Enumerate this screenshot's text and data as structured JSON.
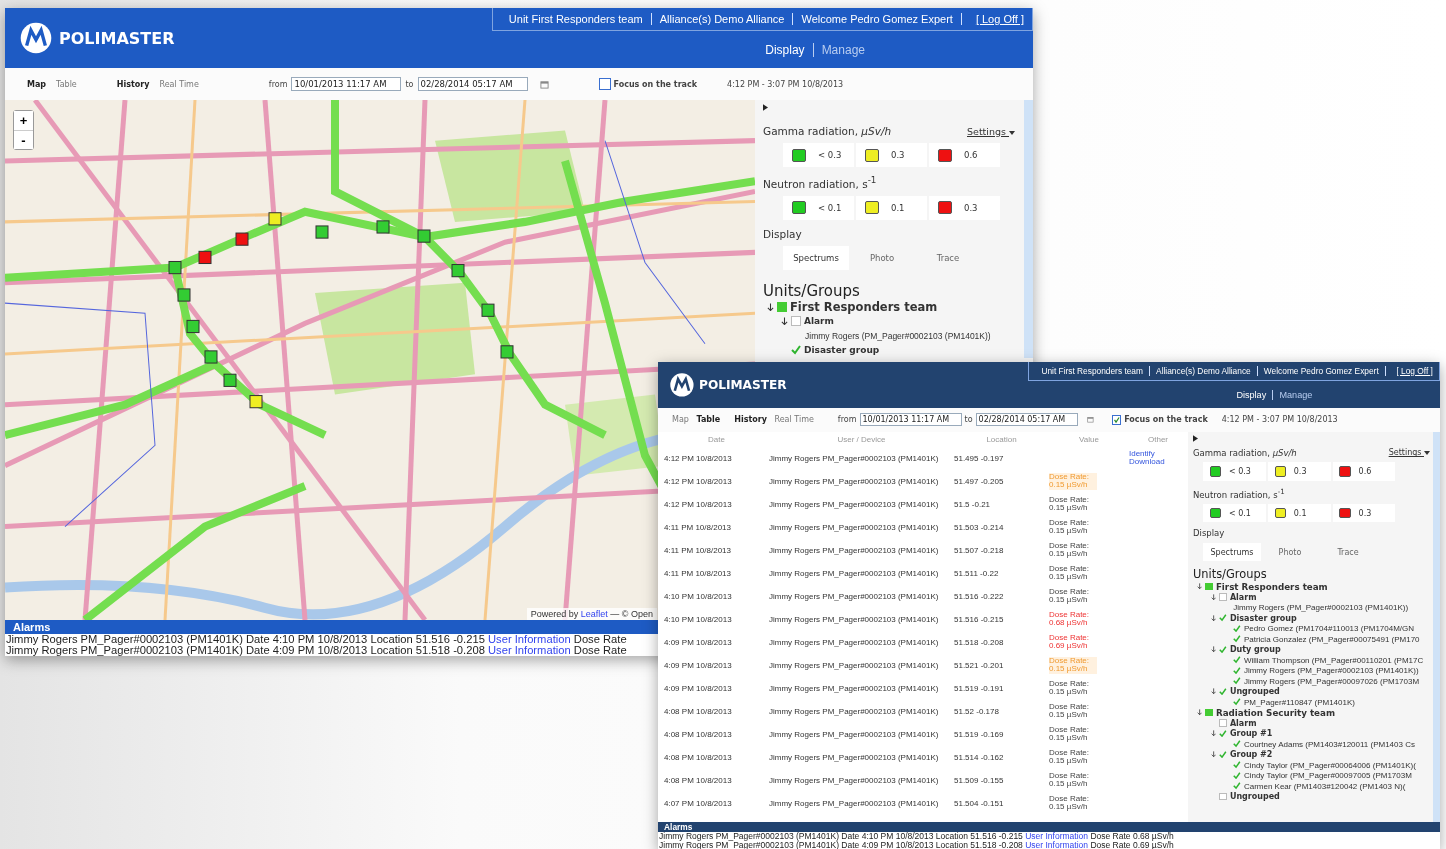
{
  "windows": [
    {
      "kind": "map",
      "brand": "POLIMASTER",
      "header_links": [
        "Unit First Responders team",
        "Alliance(s) Demo Alliance",
        "Welcome Pedro Gomez Expert"
      ],
      "logoff": "[ Log Off ]",
      "nav": [
        {
          "label": "Display",
          "selected": true
        },
        {
          "label": "Manage",
          "selected": false
        }
      ],
      "toolbar": {
        "views": [
          {
            "label": "Map",
            "selected": true
          },
          {
            "label": "Table",
            "selected": false
          }
        ],
        "modes": [
          {
            "label": "History",
            "selected": true
          },
          {
            "label": "Real Time",
            "selected": false
          }
        ],
        "from_label": "from",
        "from": "10/01/2013 11:17 AM",
        "to_label": "to",
        "to": "02/28/2014 05:17 AM",
        "focus": {
          "label": "Focus on the track",
          "checked": false
        },
        "range": "4:12 PM - 3:07 PM 10/8/2013"
      },
      "map": {
        "zoom_in": "+",
        "zoom_out": "-",
        "attribution_prefix": "Powered by",
        "attribution_link": "Leaflet",
        "attribution_suffix": "— © Open"
      },
      "panel": {
        "gamma_title": "Gamma radiation, *µSv/h*",
        "settings": "Settings",
        "gamma": [
          {
            "color": "#22cc22",
            "label": "< 0.3"
          },
          {
            "color": "#eeee22",
            "label": "0.3"
          },
          {
            "color": "#ee1111",
            "label": "0.6"
          }
        ],
        "neutron_title": "Neutron radiation, s$^{-1}$",
        "neutron": [
          {
            "color": "#22cc22",
            "label": "< 0.1"
          },
          {
            "color": "#eeee22",
            "label": "0.1"
          },
          {
            "color": "#ee1111",
            "label": "0.3"
          }
        ],
        "display_label": "Display",
        "display_tabs": [
          {
            "label": "Spectrums",
            "selected": true
          },
          {
            "label": "Photo",
            "selected": false
          },
          {
            "label": "Trace",
            "selected": false
          }
        ],
        "units_title": "Units/Groups",
        "tree": [
          {
            "kind": "team",
            "label": "First Responders team",
            "checked": true,
            "children": [
              {
                "kind": "group",
                "label": "Alarm",
                "checked": false,
                "children": [
                  {
                    "kind": "member",
                    "label": "Jimmy Rogers (PM_Pager#0002103 (PM1401K))"
                  }
                ]
              },
              {
                "kind": "group",
                "label": "Disaster group",
                "checked": true
              }
            ]
          }
        ]
      },
      "alarms": {
        "title": "Alarms",
        "rows": [
          {
            "text": "Jimmy Rogers PM_Pager#0002103 (PM1401K) Date 4:10 PM 10/8/2013 Location 51.516 -0.215",
            "link": "User Information",
            "tail": "Dose Rate"
          },
          {
            "text": "Jimmy Rogers PM_Pager#0002103 (PM1401K) Date 4:09 PM 10/8/2013 Location 51.518 -0.208",
            "link": "User Information",
            "tail": "Dose Rate"
          }
        ]
      }
    },
    {
      "kind": "table",
      "brand": "POLIMASTER",
      "header_links": [
        "Unit First Responders team",
        "Alliance(s) Demo Alliance",
        "Welcome Pedro Gomez Expert"
      ],
      "logoff": "[ Log Off ]",
      "nav": [
        {
          "label": "Display",
          "selected": true
        },
        {
          "label": "Manage",
          "selected": false
        }
      ],
      "toolbar": {
        "views": [
          {
            "label": "Map",
            "selected": false
          },
          {
            "label": "Table",
            "selected": true
          }
        ],
        "modes": [
          {
            "label": "History",
            "selected": true
          },
          {
            "label": "Real Time",
            "selected": false
          }
        ],
        "from_label": "from",
        "from": "10/01/2013 11:17 AM",
        "to_label": "to",
        "to": "02/28/2014 05:17 AM",
        "focus": {
          "label": "Focus on the track",
          "checked": true
        },
        "range": "4:12 PM - 3:07 PM 10/8/2013"
      },
      "table": {
        "columns": [
          "Date",
          "User / Device",
          "Location",
          "Value",
          "Other"
        ],
        "rows": [
          {
            "date": "4:12 PM 10/8/2013",
            "device": "Jimmy Rogers PM_Pager#0002103 (PM1401K)",
            "location": "51.495 -0.197",
            "kind": "none",
            "other": [
              "Identify",
              "Download"
            ]
          },
          {
            "date": "4:12 PM 10/8/2013",
            "device": "Jimmy Rogers PM_Pager#0002103 (PM1401K)",
            "location": "51.497 -0.205",
            "kind": "warning",
            "value": "Dose Rate: 0.15 µSv/h"
          },
          {
            "date": "4:12 PM 10/8/2013",
            "device": "Jimmy Rogers PM_Pager#0002103 (PM1401K)",
            "location": "51.5 -0.21",
            "kind": "normal",
            "value": "Dose Rate: 0.15 µSv/h"
          },
          {
            "date": "4:11 PM 10/8/2013",
            "device": "Jimmy Rogers PM_Pager#0002103 (PM1401K)",
            "location": "51.503 -0.214",
            "kind": "normal",
            "value": "Dose Rate: 0.15 µSv/h"
          },
          {
            "date": "4:11 PM 10/8/2013",
            "device": "Jimmy Rogers PM_Pager#0002103 (PM1401K)",
            "location": "51.507 -0.218",
            "kind": "normal",
            "value": "Dose Rate: 0.15 µSv/h"
          },
          {
            "date": "4:11 PM 10/8/2013",
            "device": "Jimmy Rogers PM_Pager#0002103 (PM1401K)",
            "location": "51.511 -0.22",
            "kind": "normal",
            "value": "Dose Rate: 0.15 µSv/h"
          },
          {
            "date": "4:10 PM 10/8/2013",
            "device": "Jimmy Rogers PM_Pager#0002103 (PM1401K)",
            "location": "51.516 -0.222",
            "kind": "normal",
            "value": "Dose Rate: 0.15 µSv/h"
          },
          {
            "date": "4:10 PM 10/8/2013",
            "device": "Jimmy Rogers PM_Pager#0002103 (PM1401K)",
            "location": "51.516 -0.215",
            "kind": "alarm",
            "value": "Dose Rate: 0.68 µSv/h"
          },
          {
            "date": "4:09 PM 10/8/2013",
            "device": "Jimmy Rogers PM_Pager#0002103 (PM1401K)",
            "location": "51.518 -0.208",
            "kind": "alarm",
            "value": "Dose Rate: 0.69 µSv/h"
          },
          {
            "date": "4:09 PM 10/8/2013",
            "device": "Jimmy Rogers PM_Pager#0002103 (PM1401K)",
            "location": "51.521 -0.201",
            "kind": "warning",
            "value": "Dose Rate: 0.15 µSv/h"
          },
          {
            "date": "4:09 PM 10/8/2013",
            "device": "Jimmy Rogers PM_Pager#0002103 (PM1401K)",
            "location": "51.519 -0.191",
            "kind": "normal",
            "value": "Dose Rate: 0.15 µSv/h"
          },
          {
            "date": "4:08 PM 10/8/2013",
            "device": "Jimmy Rogers PM_Pager#0002103 (PM1401K)",
            "location": "51.52 -0.178",
            "kind": "normal",
            "value": "Dose Rate: 0.15 µSv/h"
          },
          {
            "date": "4:08 PM 10/8/2013",
            "device": "Jimmy Rogers PM_Pager#0002103 (PM1401K)",
            "location": "51.519 -0.169",
            "kind": "normal",
            "value": "Dose Rate: 0.15 µSv/h"
          },
          {
            "date": "4:08 PM 10/8/2013",
            "device": "Jimmy Rogers PM_Pager#0002103 (PM1401K)",
            "location": "51.514 -0.162",
            "kind": "normal",
            "value": "Dose Rate: 0.15 µSv/h"
          },
          {
            "date": "4:08 PM 10/8/2013",
            "device": "Jimmy Rogers PM_Pager#0002103 (PM1401K)",
            "location": "51.509 -0.155",
            "kind": "normal",
            "value": "Dose Rate: 0.15 µSv/h"
          },
          {
            "date": "4:07 PM 10/8/2013",
            "device": "Jimmy Rogers PM_Pager#0002103 (PM1401K)",
            "location": "51.504 -0.151",
            "kind": "normal",
            "value": "Dose Rate: 0.15 µSv/h"
          }
        ]
      },
      "panel": {
        "gamma_title": "Gamma radiation, *µSv/h*",
        "settings": "Settings",
        "gamma": [
          {
            "color": "#22cc22",
            "label": "< 0.3"
          },
          {
            "color": "#eeee22",
            "label": "0.3"
          },
          {
            "color": "#ee1111",
            "label": "0.6"
          }
        ],
        "neutron_title": "Neutron radiation, s$^{-1}$",
        "neutron": [
          {
            "color": "#22cc22",
            "label": "< 0.1"
          },
          {
            "color": "#eeee22",
            "label": "0.1"
          },
          {
            "color": "#ee1111",
            "label": "0.3"
          }
        ],
        "display_label": "Display",
        "display_tabs": [
          {
            "label": "Spectrums",
            "selected": true
          },
          {
            "label": "Photo",
            "selected": false
          },
          {
            "label": "Trace",
            "selected": false
          }
        ],
        "units_title": "Units/Groups",
        "tree": [
          {
            "kind": "team",
            "label": "First Responders team",
            "checked": true,
            "children": [
              {
                "kind": "group",
                "label": "Alarm",
                "checked": false,
                "children": [
                  {
                    "kind": "member",
                    "label": "Jimmy Rogers (PM_Pager#0002103 (PM1401K))"
                  }
                ]
              },
              {
                "kind": "group",
                "label": "Disaster group",
                "checked": true,
                "children": [
                  {
                    "kind": "device",
                    "label": "Pedro Gomez (PM1704#110013 (PM1704M/GN",
                    "checked": true
                  },
                  {
                    "kind": "device",
                    "label": "Patricia Gonzalez (PM_Pager#00075491 (PM170",
                    "checked": true
                  }
                ]
              },
              {
                "kind": "group",
                "label": "Duty group",
                "checked": true,
                "children": [
                  {
                    "kind": "device",
                    "label": "William Thompson (PM_Pager#00110201 (PM17C",
                    "checked": true
                  },
                  {
                    "kind": "device",
                    "label": "Jimmy Rogers (PM_Pager#0002103 (PM1401K))",
                    "checked": true
                  },
                  {
                    "kind": "device",
                    "label": "Jimmy Rogers (PM_Pager#00097026 (PM1703M",
                    "checked": true
                  }
                ]
              },
              {
                "kind": "group",
                "label": "Ungrouped",
                "checked": true,
                "children": [
                  {
                    "kind": "device",
                    "label": "PM_Pager#110847 (PM1401K)",
                    "checked": true
                  }
                ]
              }
            ]
          },
          {
            "kind": "team",
            "label": "Radiation Security team",
            "checked": true,
            "children": [
              {
                "kind": "group",
                "label": "Alarm",
                "checked": false
              },
              {
                "kind": "group",
                "label": "Group #1",
                "checked": true,
                "children": [
                  {
                    "kind": "device",
                    "label": "Courtney Adams (PM1403#120011 (PM1403 Cs",
                    "checked": true
                  }
                ]
              },
              {
                "kind": "group",
                "label": "Group #2",
                "checked": true,
                "children": [
                  {
                    "kind": "device",
                    "label": "Cindy Taylor (PM_Pager#00064006 (PM1401K)(",
                    "checked": true
                  },
                  {
                    "kind": "device",
                    "label": "Cindy Taylor (PM_Pager#00097005 (PM1703M",
                    "checked": true
                  },
                  {
                    "kind": "device",
                    "label": "Carmen Kear (PM1403#120042 (PM1403 N)(",
                    "checked": true
                  }
                ]
              },
              {
                "kind": "group",
                "label": "Ungrouped",
                "checked": false
              }
            ]
          }
        ]
      },
      "alarms": {
        "title": "Alarms",
        "rows": [
          {
            "text": "Jimmy Rogers PM_Pager#0002103 (PM1401K) Date 4:10 PM 10/8/2013 Location 51.516 -0.215",
            "link": "User Information",
            "tail": "Dose Rate 0.68 µSv/h"
          },
          {
            "text": "Jimmy Rogers PM_Pager#0002103 (PM1401K) Date 4:09 PM 10/8/2013 Location 51.518 -0.208",
            "link": "User Information",
            "tail": "Dose Rate 0.69 µSv/h"
          }
        ]
      }
    }
  ]
}
